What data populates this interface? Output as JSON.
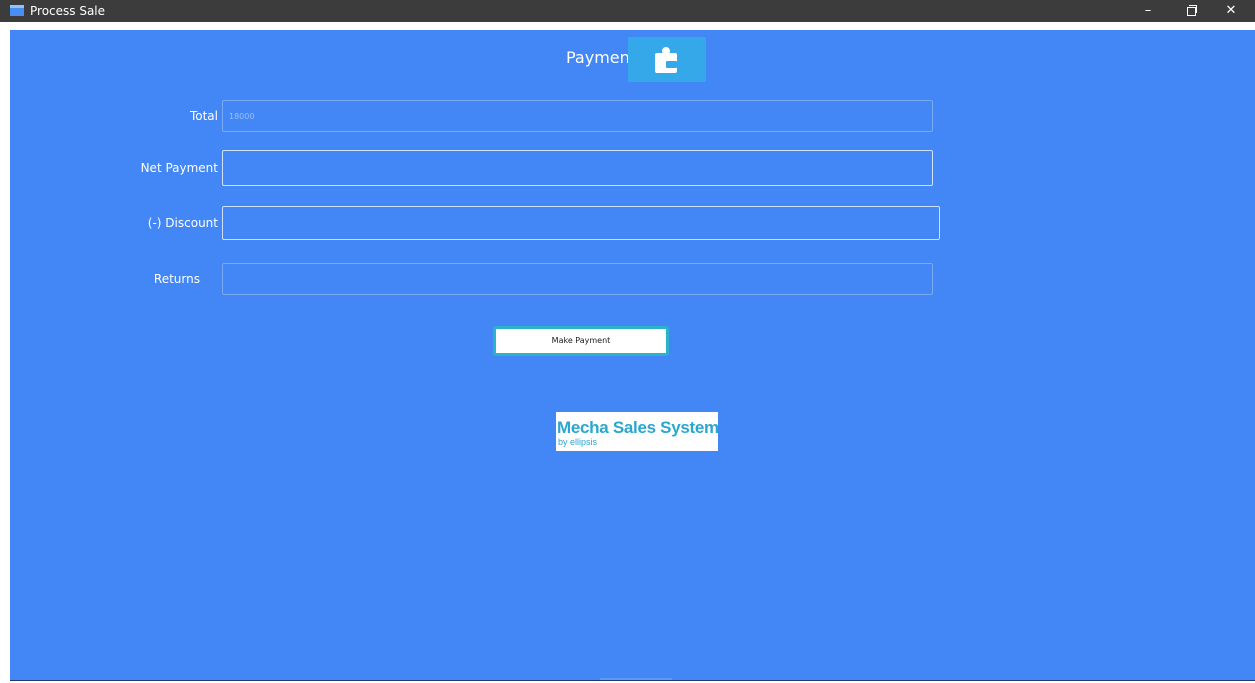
{
  "window": {
    "title": "Process Sale",
    "minimize_label": "–",
    "close_label": "✕"
  },
  "header": {
    "title": "Payment",
    "icon": "wallet-icon"
  },
  "form": {
    "total": {
      "label": "Total",
      "value": "18000"
    },
    "net_payment": {
      "label": "Net Payment",
      "value": ""
    },
    "discount": {
      "label": "(-) Discount",
      "value": ""
    },
    "returns": {
      "label": "Returns",
      "value": ""
    }
  },
  "actions": {
    "make_payment_label": "Make Payment"
  },
  "branding": {
    "logo_text": "Mecha Sales System",
    "logo_subtext": "by ellipsis"
  },
  "colors": {
    "background": "#4287f5",
    "titlebar": "#3c3c3c",
    "icon_box": "#35a8ea",
    "button_border": "#2ab3c9",
    "logo_text": "#2aa7cf"
  }
}
